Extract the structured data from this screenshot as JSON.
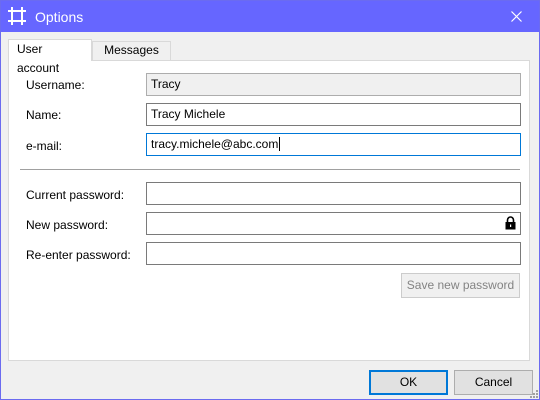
{
  "window": {
    "title": "Options",
    "app_icon": "crop-icon",
    "close_icon": "close-icon"
  },
  "tabs": [
    {
      "label": "User account",
      "active": true
    },
    {
      "label": "Messages",
      "active": false
    }
  ],
  "user_account": {
    "username_label": "Username:",
    "username_value": "Tracy",
    "name_label": "Name:",
    "name_value": "Tracy Michele",
    "email_label": "e-mail:",
    "email_value": "tracy.michele@abc.com",
    "current_password_label": "Current password:",
    "current_password_value": "",
    "new_password_label": "New password:",
    "new_password_value": "",
    "reenter_password_label": "Re-enter password:",
    "reenter_password_value": "",
    "save_password_button": "Save new password"
  },
  "footer": {
    "ok_label": "OK",
    "cancel_label": "Cancel"
  },
  "colors": {
    "titlebar": "#6666ff",
    "focus_border": "#0078d7"
  }
}
